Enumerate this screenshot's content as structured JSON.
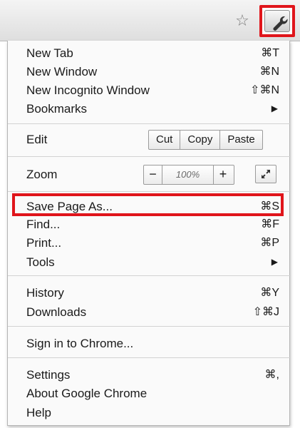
{
  "toolbar": {
    "star_icon": "star-icon",
    "wrench_icon": "wrench-icon",
    "highlight_color": "#e0151b"
  },
  "menu": {
    "new_tab": {
      "label": "New Tab",
      "shortcut": "⌘T"
    },
    "new_window": {
      "label": "New Window",
      "shortcut": "⌘N"
    },
    "new_incognito": {
      "label": "New Incognito Window",
      "shortcut": "⇧⌘N"
    },
    "bookmarks": {
      "label": "Bookmarks",
      "arrow": "▶"
    },
    "edit": {
      "label": "Edit",
      "cut": "Cut",
      "copy": "Copy",
      "paste": "Paste"
    },
    "zoom": {
      "label": "Zoom",
      "minus": "−",
      "value": "100%",
      "plus": "+"
    },
    "save_page": {
      "label": "Save Page As...",
      "shortcut": "⌘S"
    },
    "find": {
      "label": "Find...",
      "shortcut": "⌘F"
    },
    "print": {
      "label": "Print...",
      "shortcut": "⌘P"
    },
    "tools": {
      "label": "Tools",
      "arrow": "▶"
    },
    "history": {
      "label": "History",
      "shortcut": "⌘Y"
    },
    "downloads": {
      "label": "Downloads",
      "shortcut": "⇧⌘J"
    },
    "sign_in": {
      "label": "Sign in to Chrome..."
    },
    "settings": {
      "label": "Settings",
      "shortcut": "⌘,"
    },
    "about": {
      "label": "About Google Chrome"
    },
    "help": {
      "label": "Help"
    }
  }
}
